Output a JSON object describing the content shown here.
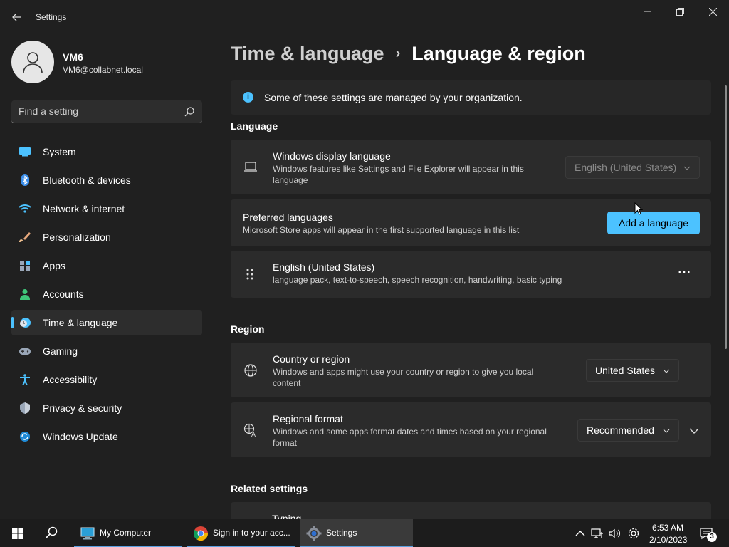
{
  "window": {
    "title": "Settings",
    "back_icon": "back-arrow-icon",
    "minimize_icon": "minimize-icon",
    "restore_icon": "restore-icon",
    "close_icon": "close-icon"
  },
  "profile": {
    "name": "VM6",
    "email": "VM6@collabnet.local"
  },
  "search": {
    "placeholder": "Find a setting"
  },
  "sidebar": {
    "items": [
      {
        "label": "System",
        "icon": "system-icon",
        "active": false
      },
      {
        "label": "Bluetooth & devices",
        "icon": "bluetooth-icon",
        "active": false
      },
      {
        "label": "Network & internet",
        "icon": "wifi-icon",
        "active": false
      },
      {
        "label": "Personalization",
        "icon": "brush-icon",
        "active": false
      },
      {
        "label": "Apps",
        "icon": "apps-icon",
        "active": false
      },
      {
        "label": "Accounts",
        "icon": "person-icon",
        "active": false
      },
      {
        "label": "Time & language",
        "icon": "clock-globe-icon",
        "active": true
      },
      {
        "label": "Gaming",
        "icon": "gamepad-icon",
        "active": false
      },
      {
        "label": "Accessibility",
        "icon": "accessibility-icon",
        "active": false
      },
      {
        "label": "Privacy & security",
        "icon": "shield-icon",
        "active": false
      },
      {
        "label": "Windows Update",
        "icon": "update-icon",
        "active": false
      }
    ]
  },
  "breadcrumb": {
    "parent": "Time & language",
    "separator": "›",
    "current": "Language & region"
  },
  "info": {
    "text": "Some of these settings are managed by your organization.",
    "icon": "i"
  },
  "language": {
    "heading": "Language",
    "display": {
      "title": "Windows display language",
      "subtitle": "Windows features like Settings and File Explorer will appear in this language",
      "value": "English (United States)"
    },
    "preferred": {
      "title": "Preferred languages",
      "subtitle": "Microsoft Store apps will appear in the first supported language in this list",
      "button": "Add a language"
    },
    "entry": {
      "title": "English (United States)",
      "subtitle": "language pack, text-to-speech, speech recognition, handwriting, basic typing",
      "more": "···"
    }
  },
  "region": {
    "heading": "Region",
    "country": {
      "title": "Country or region",
      "subtitle": "Windows and apps might use your country or region to give you local content",
      "value": "United States"
    },
    "format": {
      "title": "Regional format",
      "subtitle": "Windows and some apps format dates and times based on your regional format",
      "value": "Recommended"
    }
  },
  "related": {
    "heading": "Related settings",
    "partial_item": "Typing"
  },
  "taskbar": {
    "apps": [
      {
        "label": "My Computer",
        "icon": "computer-icon"
      },
      {
        "label": "Sign in to your acc...",
        "icon": "chrome-icon"
      },
      {
        "label": "Settings",
        "icon": "settings-gear-icon"
      }
    ],
    "time": "6:53 AM",
    "date": "2/10/2023",
    "notifications": "3"
  },
  "colors": {
    "accent": "#4cc2ff",
    "background": "#202020",
    "card": "#2b2b2b"
  }
}
